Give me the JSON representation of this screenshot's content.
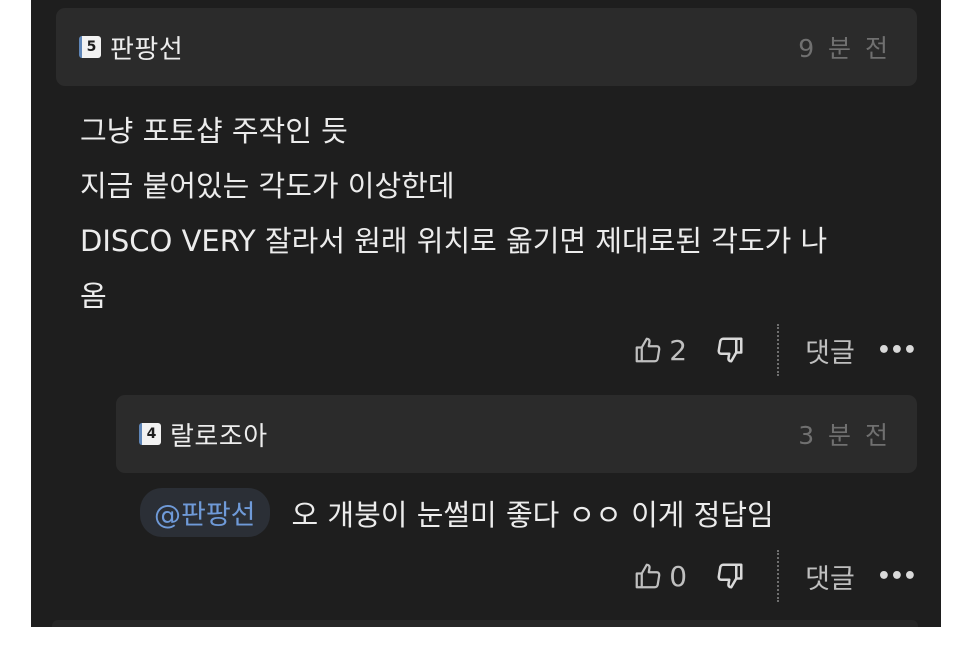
{
  "comment": {
    "level": "5",
    "username": "판팡선",
    "time": "9 분 전",
    "lines": [
      "그냥 포토샵 주작인 듯",
      "지금 붙어있는 각도가 이상한데",
      "DISCO VERY 잘라서 원래 위치로 옮기면 제대로된 각도가 나",
      "옴"
    ],
    "likes": "2",
    "reply_label": "댓글",
    "more_label": "•••"
  },
  "reply": {
    "level": "4",
    "username": "랄로조아",
    "time": "3 분 전",
    "mention": "@판팡선",
    "text": "오 개붕이 눈썰미 좋다 ㅇㅇ 이게 정답임",
    "likes": "0",
    "reply_label": "댓글",
    "more_label": "•••"
  },
  "colors": {
    "background": "#1e1e1e",
    "header": "#2b2b2b",
    "mention": "#6f9ad8"
  },
  "icons": [
    "thumbs-up-icon",
    "thumbs-down-icon",
    "more-icon",
    "level-badge-icon"
  ]
}
